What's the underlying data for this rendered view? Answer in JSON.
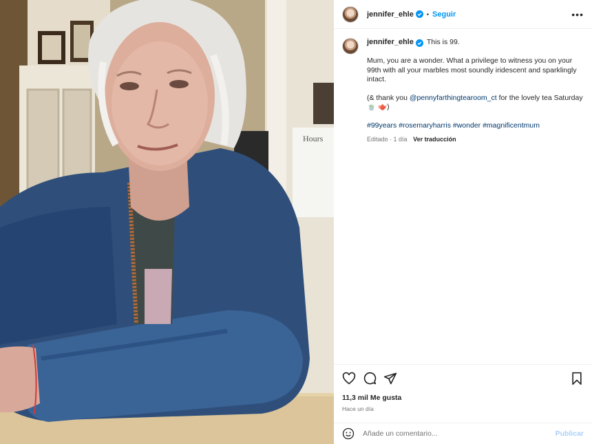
{
  "header": {
    "username": "jennifer_ehle",
    "follow_label": "Seguir",
    "more_label": "•••"
  },
  "caption": {
    "username": "jennifer_ehle",
    "title": "This is 99.",
    "paragraph1": "Mum, you are a wonder. What a privilege to witness you on your 99th with all your marbles most soundly iridescent and sparklingly intact.",
    "paragraph2_prefix": "(& thank you ",
    "mention": "@pennyfarthingtearoom_ct",
    "paragraph2_suffix": " for the lovely tea Saturday 🍵 🫖)",
    "hashtags": "#99years #rosemaryharris #wonder #magnificentmum",
    "edited": "Editado · 1 día",
    "translate": "Ver traducción"
  },
  "engagement": {
    "likes": "11,3 mil Me gusta",
    "time": "Hace un día"
  },
  "comment": {
    "placeholder": "Añade un comentario...",
    "publish": "Publicar"
  },
  "icons": {
    "verified": "verified-badge-icon",
    "like": "heart-icon",
    "comment": "comment-icon",
    "share": "share-icon",
    "save": "bookmark-icon",
    "emoji": "emoji-icon",
    "more": "more-options-icon"
  },
  "colors": {
    "link": "#0095f6",
    "mention": "#00376b",
    "muted": "#737373",
    "publish_disabled": "#a8cffa"
  }
}
